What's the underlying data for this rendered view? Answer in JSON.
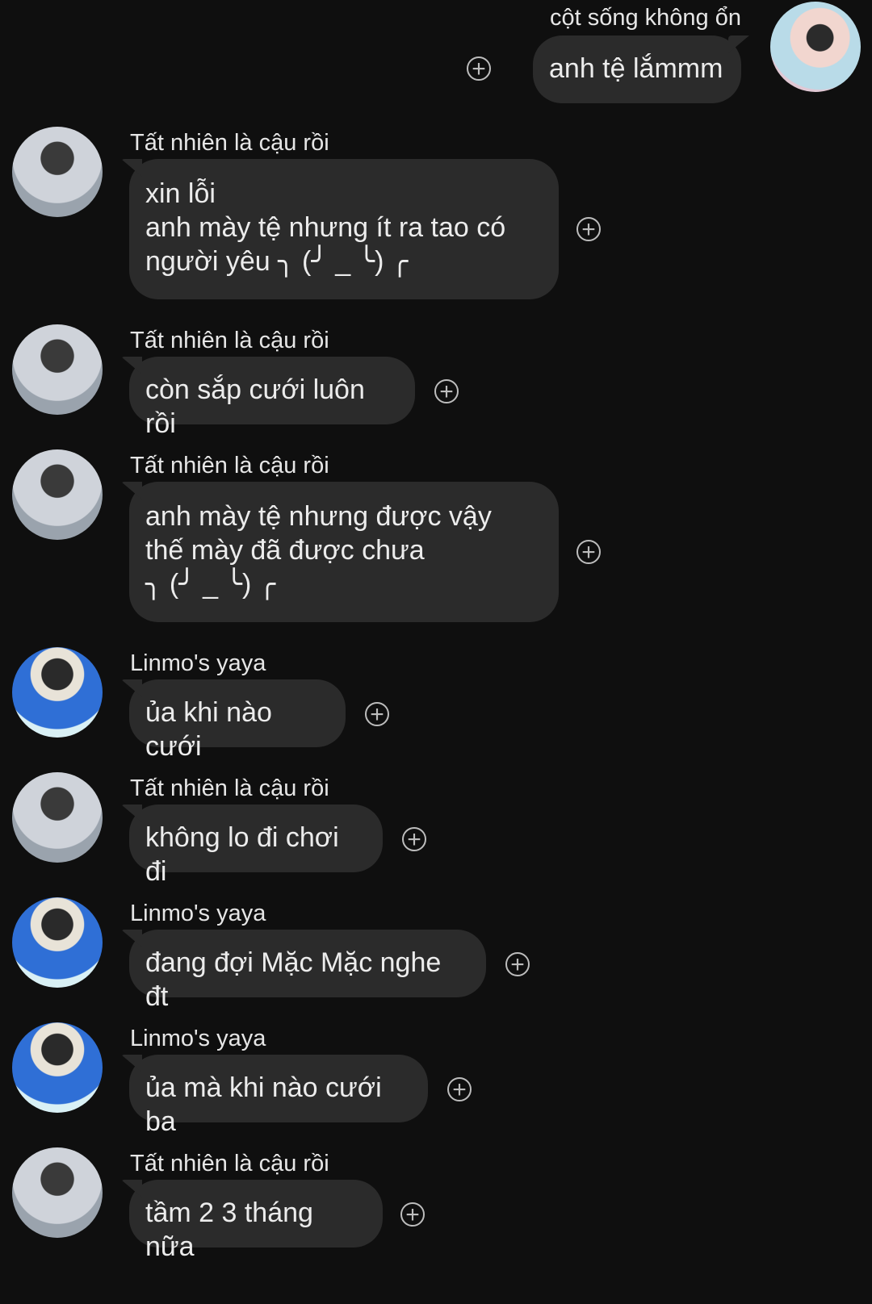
{
  "messages": [
    {
      "sender": "cột sống không ổn",
      "text": "anh tệ lắmmm",
      "avatar": "self-avatar"
    },
    {
      "sender": "Tất nhiên là cậu rồi",
      "text": "xin lỗi\nanh mày tệ nhưng ít ra tao có\nngười yêu ╮ (╯ _ ╰) ╭",
      "avatar": "hoodie-avatar"
    },
    {
      "sender": "Tất nhiên là cậu rồi",
      "text": "còn sắp cưới luôn rồi",
      "avatar": "hoodie-avatar"
    },
    {
      "sender": "Tất nhiên là cậu rồi",
      "text": "anh mày tệ nhưng được vậy\nthế mày đã được chưa\n╮ (╯ _ ╰) ╭",
      "avatar": "hoodie-avatar"
    },
    {
      "sender": "Linmo's yaya",
      "text": "ủa khi nào cưới",
      "avatar": "blue-jacket-avatar"
    },
    {
      "sender": "Tất nhiên là cậu rồi",
      "text": "không lo đi chơi đi",
      "avatar": "hoodie-avatar"
    },
    {
      "sender": "Linmo's yaya",
      "text": "đang đợi Mặc Mặc nghe đt",
      "avatar": "blue-jacket-avatar"
    },
    {
      "sender": "Linmo's yaya",
      "text": "ủa mà khi nào cưới ba",
      "avatar": "blue-jacket-avatar"
    },
    {
      "sender": "Tất nhiên là cậu rồi",
      "text": "tầm 2 3 tháng nữa",
      "avatar": "hoodie-avatar"
    }
  ],
  "icons": {
    "reaction": "add-reaction-icon",
    "reaction_glyph": "+"
  }
}
